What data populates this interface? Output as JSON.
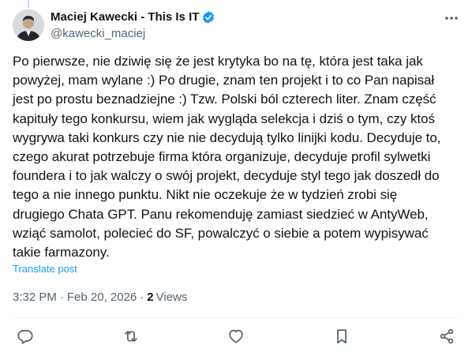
{
  "author": {
    "display_name": "Maciej Kawecki - This Is IT",
    "handle": "@kawecki_maciej"
  },
  "tweet": {
    "text": "Po pierwsze, nie dziwię się że jest krytyka bo na tę, która jest taka jak\npowyżej, mam wylane :) Po drugie, znam ten projekt i to co Pan napisał\njest po prostu beznadziejne :) Tzw. Polski ból czterech liter. Znam część\nkapituły tego konkursu, wiem jak wygląda selekcja i dziś o tym, czy ktoś\nwygrywa taki konkurs czy nie nie decydują tylko linijki kodu. Decyduje to,\nczego akurat potrzebuje firma która organizuje, decyduje profil sylwetki\nfoundera i to jak walczy o swój projekt, decyduje styl tego jak doszedł do\ntego a nie innego punktu. Nikt nie oczekuje że w tydzień zrobi się\ndrugiego Chata GPT. Panu rekomenduję zamiast siedzieć w AntyWeb,\nwziąć samolot, polecieć do SF, powalczyć o siebie a potem wypisywać\ntakie farmazony.",
    "translate_label": "Translate post",
    "time": "3:32 PM",
    "date": "Feb 20, 2026",
    "separator": "·",
    "views_count": "2",
    "views_label": "Views"
  },
  "icons": {
    "more": "more-dots-icon",
    "verified": "verified-badge-icon",
    "reply": "reply-icon",
    "retweet": "retweet-icon",
    "like": "heart-icon",
    "bookmark": "bookmark-icon",
    "share": "share-icon"
  },
  "colors": {
    "accent": "#1d9bf0",
    "text": "#0f1419",
    "secondary": "#536471",
    "divider": "#eff3f4"
  }
}
